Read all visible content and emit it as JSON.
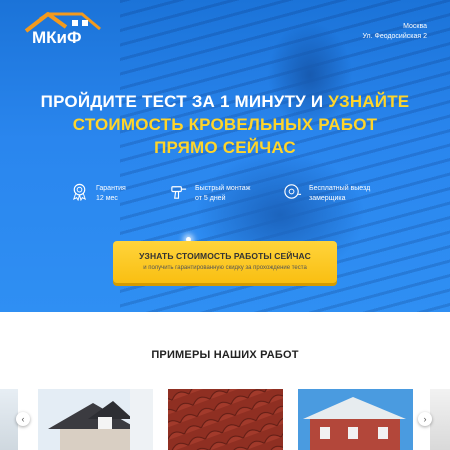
{
  "brand": {
    "logo_text": "МКиФ"
  },
  "address": {
    "city": "Москва",
    "street": "Ул. Феодосийская 2"
  },
  "headline": {
    "line1_white": "ПРОЙДИТЕ ТЕСТ ЗА 1 МИНУТУ И ",
    "line1_yellow": "УЗНАЙТЕ",
    "line2": "СТОИМОСТЬ КРОВЕЛЬНЫХ РАБОТ",
    "line3": "ПРЯМО СЕЙЧАС"
  },
  "features": [
    {
      "icon": "medal-icon",
      "line1": "Гарантия",
      "line2": "12 мес"
    },
    {
      "icon": "drill-icon",
      "line1": "Быстрый монтаж",
      "line2": "от 5 дней"
    },
    {
      "icon": "tape-measure-icon",
      "line1": "Бесплатный выезд",
      "line2": "замерщика"
    }
  ],
  "cta": {
    "label": "УЗНАТЬ СТОИМОСТЬ РАБОТЫ СЕЙЧАС",
    "sublabel": "и получить гарантированную скидку за прохождение теста"
  },
  "works": {
    "title": "ПРИМЕРЫ НАШИХ РАБОТ"
  },
  "colors": {
    "accent": "#ffd52a",
    "hero_blue": "#2a86ee",
    "cta": "#f9bf12"
  }
}
